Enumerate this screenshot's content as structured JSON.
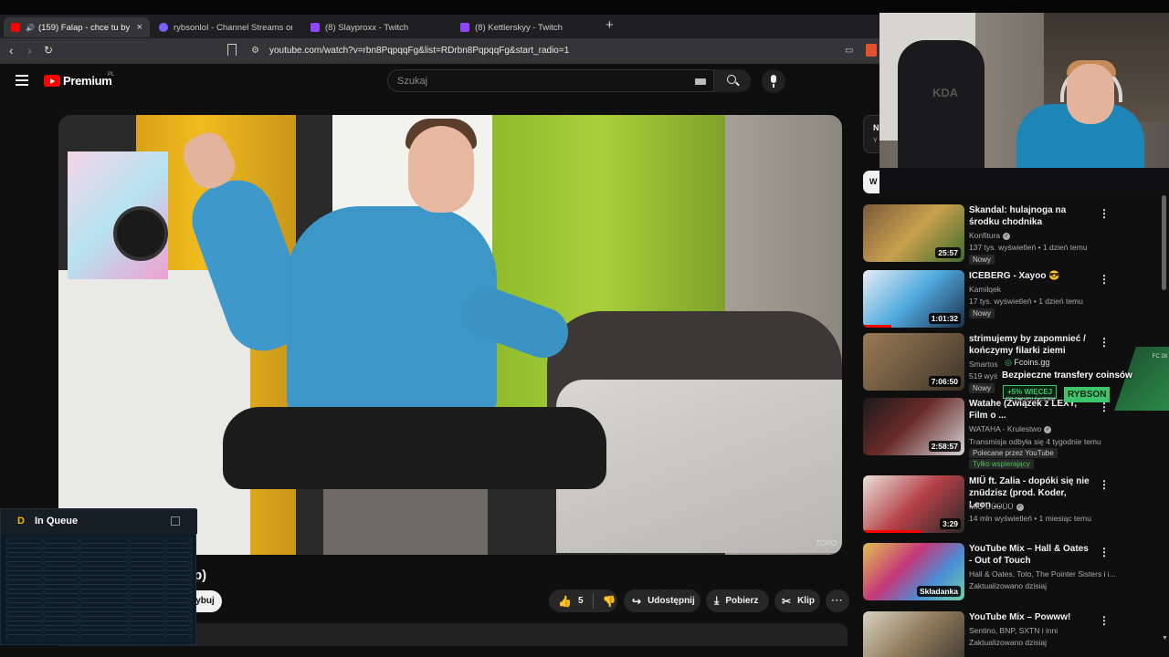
{
  "browser": {
    "tabs": [
      {
        "label": "(159) Falap - chce tu być (hm",
        "active": true,
        "icon": "youtube-icon",
        "color": "#ff0000"
      },
      {
        "label": "rybsonloI - Channel Streams on Kick",
        "active": false,
        "icon": "kick-icon",
        "color": "#7b61ff"
      },
      {
        "label": "(8) Slayproxx - Twitch",
        "active": false,
        "icon": "twitch-icon",
        "color": "#9146ff"
      },
      {
        "label": "(8) Kettlerskyy - Twitch",
        "active": false,
        "icon": "twitch-icon",
        "color": "#9146ff"
      }
    ],
    "close_label": "×",
    "new_tab_label": "+",
    "url": "youtube.com/watch?v=rbn8PqpqqFg&list=RDrbn8PqpqqFg&start_radio=1"
  },
  "youtube": {
    "brand": "Premium",
    "region": "PL",
    "search_placeholder": "Szukaj",
    "video": {
      "title_fragment": "p)",
      "subscribe_label": "ybuj",
      "likes": "5",
      "share_label": "Udostępnij",
      "download_label": "Pobierz",
      "clip_label": "Klip",
      "more_label": "···"
    },
    "live_card": {
      "title": "N",
      "sub": "Y"
    },
    "chip": "W",
    "recommendations": [
      {
        "title": "Skandal: hulajnoga na środku chodnika",
        "channel": "Konfitura",
        "verified": true,
        "meta": "137 tys. wyświetleń • 1 dzień temu",
        "badge": "Nowy",
        "duration": "25:57"
      },
      {
        "title": "ICEBERG - Xayoo 😎",
        "channel": "Kamilqek",
        "verified": false,
        "meta": "17 tys. wyświetleń • 1 dzień temu",
        "badge": "Nowy",
        "duration": "1:01:32"
      },
      {
        "title": "strimujemy by zapomnieć / kończymy filarki ziemi",
        "channel": "Smartos",
        "verified": false,
        "meta": "519 wyś",
        "badge": "Nowy",
        "duration": "7:06:50"
      },
      {
        "title": "Watahe (Związek z LEXY, Film o ...",
        "channel": "WATAHA - Krulestwo",
        "verified": true,
        "meta": "Transmisja odbyła się 4 tygodnie temu",
        "badge": "Polecane przez YouTube",
        "badge2": "Tylko wspierający",
        "duration": "2:58:57"
      },
      {
        "title": "MIÜ ft. Zalia - dopóki się nie znüdzisz (prod. Koder, Leon ...",
        "channel": "MIÜ ÜÜÜÜÜ",
        "verified": true,
        "meta": "14 mln wyświetleń • 1 miesiąc temu",
        "duration": "3:29"
      },
      {
        "title": "YouTube Mix – Hall & Oates - Out of Touch",
        "channel": "Hall & Oates, Toto, The Pointer Sisters i i...",
        "meta": "Zaktualizowano dzisiaj",
        "duration": "Składanka"
      },
      {
        "title": "YouTube Mix – Powww!",
        "channel": "Sentino, BNP, SXTN i inni",
        "meta": "Zaktualizowano dzisiaj"
      }
    ]
  },
  "webcam": {
    "chair_logo": "KDA"
  },
  "ad": {
    "brand": "Fcoins.gg",
    "corner": "FC 28",
    "headline": "Bezpieczne transfery coinsów",
    "bonus": "+5% WIĘCEJ",
    "small": "DO ZAKUPU Z KODEM",
    "code": "RYBSON"
  },
  "queue": {
    "logo": "D",
    "title": "In Queue"
  },
  "video_watermark": "TORO"
}
